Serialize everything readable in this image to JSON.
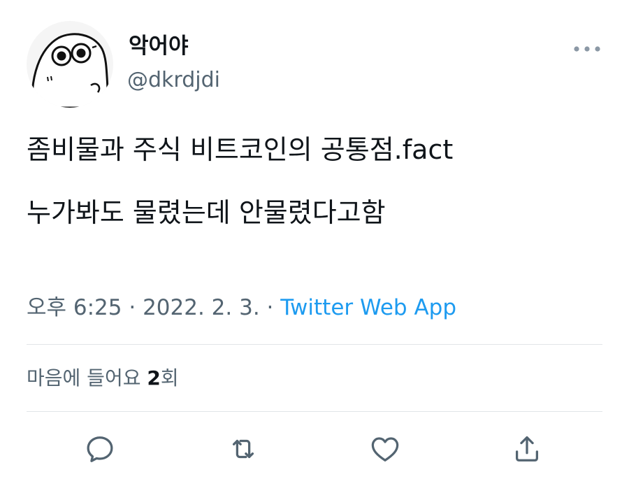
{
  "user": {
    "display_name": "악어야",
    "handle": "@dkrdjdi",
    "avatar_icon": "cartoon-avatar"
  },
  "tweet": {
    "lines": [
      "좀비물과 주식 비트코인의 공통점.fact",
      "누가봐도 물렸는데 안물렸다고함"
    ],
    "time": "오후 6:25",
    "sep1": " · ",
    "date": "2022. 2. 3.",
    "sep2": " · ",
    "source": "Twitter Web App"
  },
  "stats": {
    "likes_label": "마음에 들어요 ",
    "likes_count": "2",
    "likes_suffix": "회"
  },
  "actions": {
    "icons": [
      "reply-icon",
      "retweet-icon",
      "like-icon",
      "share-icon"
    ]
  },
  "colors": {
    "text": "#0f1419",
    "secondary": "#536471",
    "link": "#1d9bf0",
    "divider": "#e1e5e8"
  }
}
